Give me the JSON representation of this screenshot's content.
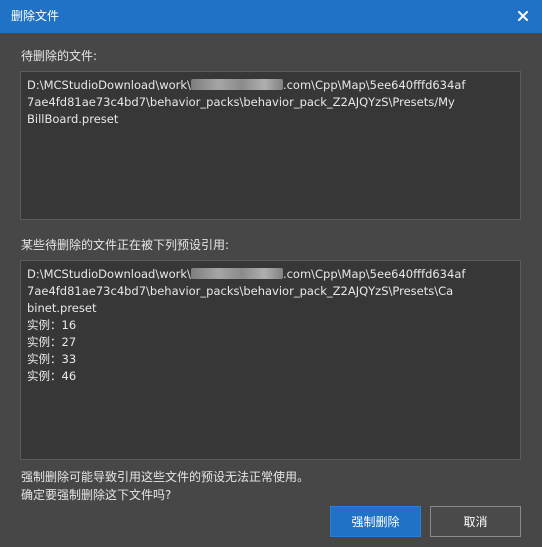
{
  "window": {
    "title": "删除文件",
    "close_icon": "close-icon"
  },
  "files_section": {
    "label": "待删除的文件:",
    "lines": [
      {
        "pre": "D:\\MCStudioDownload\\work\\",
        "post": ".com\\Cpp\\Map\\5ee640fffd634af"
      },
      {
        "text": "7ae4fd81ae73c4bd7\\behavior_packs\\behavior_pack_Z2AJQYzS\\Presets/My"
      },
      {
        "text": "BillBoard.preset"
      }
    ]
  },
  "references_section": {
    "label": "某些待删除的文件正在被下列预设引用:",
    "lines": [
      {
        "pre": "D:\\MCStudioDownload\\work\\",
        "post": ".com\\Cpp\\Map\\5ee640fffd634af"
      },
      {
        "text": "7ae4fd81ae73c4bd7\\behavior_packs\\behavior_pack_Z2AJQYzS\\Presets\\Ca"
      },
      {
        "text": "binet.preset"
      },
      {
        "text": "实例：16"
      },
      {
        "text": "实例：27"
      },
      {
        "text": "实例：33"
      },
      {
        "text": "实例：46"
      }
    ]
  },
  "warning": {
    "line1": "强制删除可能导致引用这些文件的预设无法正常使用。",
    "line2": "确定要强制删除这下文件吗?"
  },
  "buttons": {
    "force_delete": "强制删除",
    "cancel": "取消"
  },
  "colors": {
    "titlebar": "#1f72c6",
    "background": "#474747",
    "textbox": "#373737",
    "primary_button": "#1f72c6"
  }
}
